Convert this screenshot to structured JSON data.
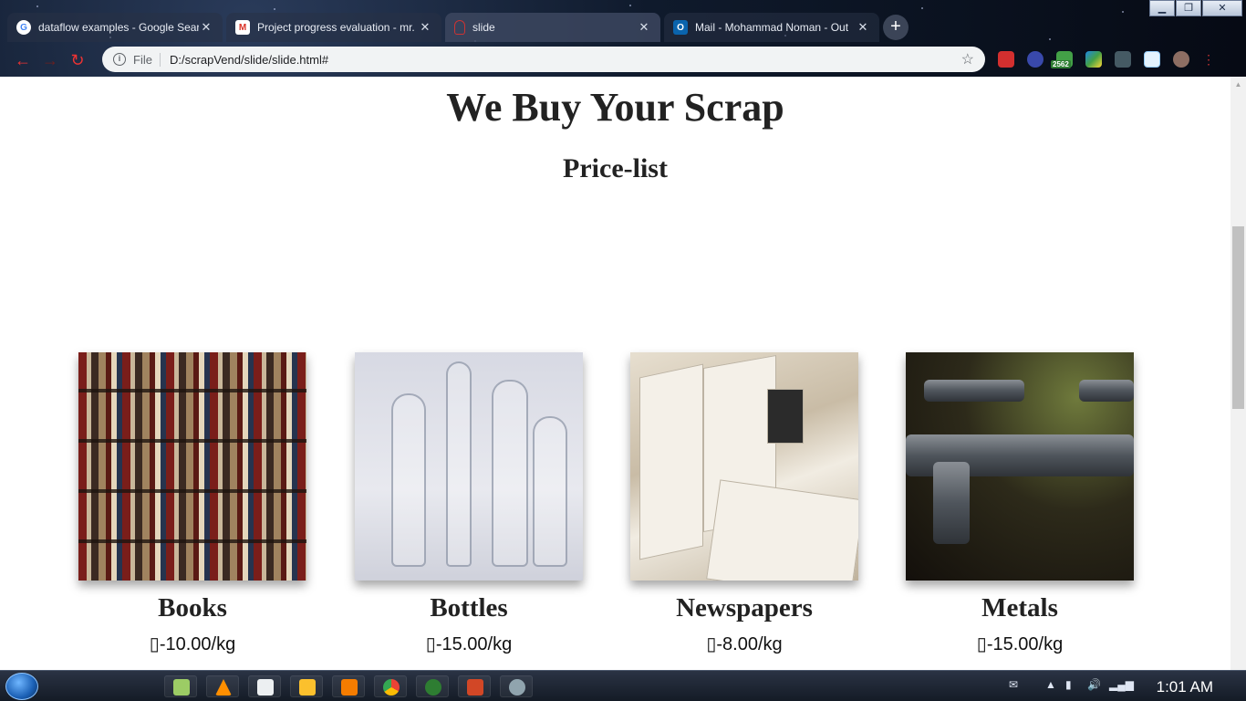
{
  "browser": {
    "tabs": [
      {
        "title": "dataflow examples - Google Sear",
        "favicon": "google-icon",
        "color": "#4285f4"
      },
      {
        "title": "Project progress evaluation - mr.",
        "favicon": "gmail-icon",
        "color": "#d93025"
      },
      {
        "title": "slide",
        "favicon": "page-icon",
        "color": "#b33"
      },
      {
        "title": "Mail - Mohammad Noman - Out",
        "favicon": "outlook-icon",
        "color": "#0a64ad"
      }
    ],
    "omnibox": {
      "scheme": "File",
      "url": "D:/scrapVend/slide/slide.html#"
    },
    "extension_badge": "2562"
  },
  "page": {
    "headline": "We Buy Your Scrap",
    "subheading": "Price-list",
    "items": [
      {
        "name": "Books",
        "price": "-10.00/kg"
      },
      {
        "name": "Bottles",
        "price": "-15.00/kg"
      },
      {
        "name": "Newspapers",
        "price": "-8.00/kg"
      },
      {
        "name": "Metals",
        "price": "-15.00/kg"
      }
    ],
    "currency_glyph": "▯"
  },
  "taskbar": {
    "clock": "1:01 AM"
  }
}
